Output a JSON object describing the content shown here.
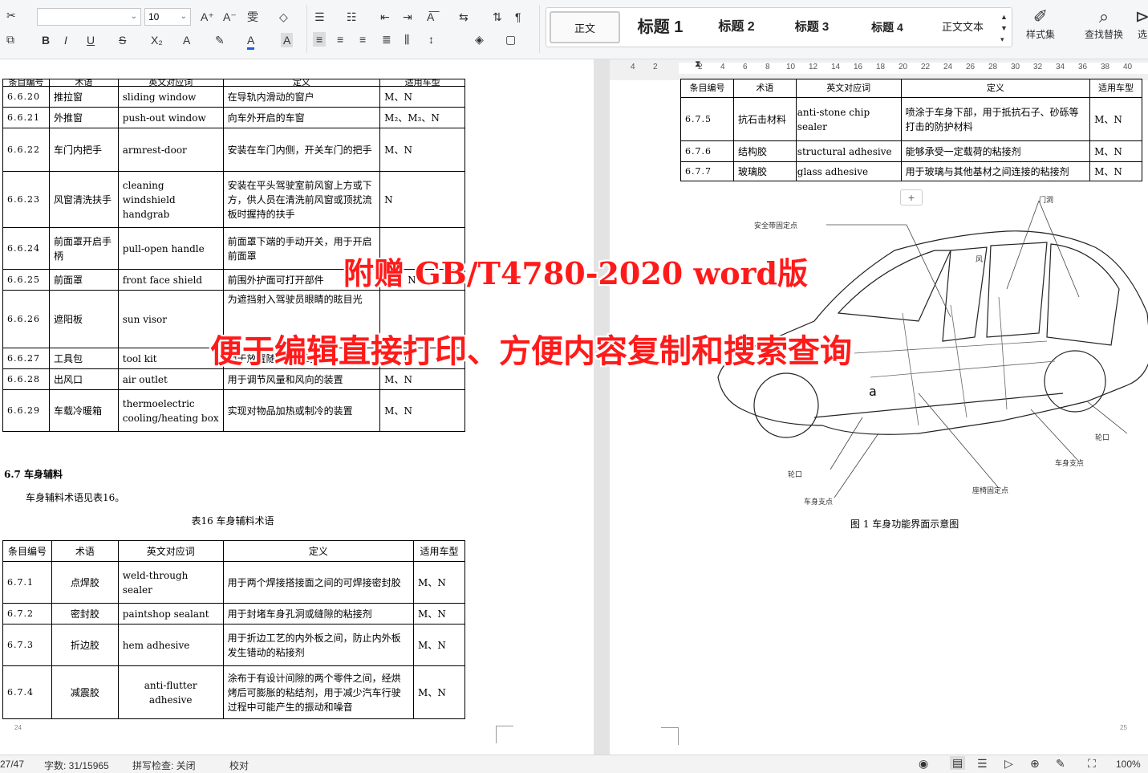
{
  "toolbar": {
    "font_name": "",
    "font_size": "10",
    "grow_font": "A⁺",
    "shrink_font": "A⁻",
    "phonetic": "雯",
    "clear": "◇",
    "bold": "B",
    "italic": "I",
    "underline": "U",
    "strike": "S",
    "subscript": "X₂",
    "highlight": "A",
    "font_color": "A",
    "char_shade": "A"
  },
  "styles": [
    {
      "label": "正文"
    },
    {
      "label": "标题 1"
    },
    {
      "label": "标题 2"
    },
    {
      "label": "标题 3"
    },
    {
      "label": "标题 4"
    },
    {
      "label": "正文文本"
    }
  ],
  "right_tools": {
    "style_set": "样式集",
    "find_replace": "查找替换",
    "select": "选"
  },
  "ruler": [
    "4",
    "2",
    "2",
    "4",
    "6",
    "8",
    "10",
    "12",
    "14",
    "16",
    "18",
    "20",
    "22",
    "24",
    "26",
    "28",
    "30",
    "32",
    "34",
    "36",
    "38",
    "40"
  ],
  "left_table_a": {
    "headers": [
      "条目编号",
      "术语",
      "英文对应词",
      "定义",
      "适用车型"
    ],
    "rows": [
      {
        "no": "6.6.20",
        "term": "推拉窗",
        "en": "sliding window",
        "def": "在导轨内滑动的窗户",
        "models": "M、N"
      },
      {
        "no": "6.6.21",
        "term": "外推窗",
        "en": "push-out window",
        "def": "向车外开启的车窗",
        "models": "M₂、M₃、N"
      },
      {
        "no": "6.6.22",
        "term": "车门内把手",
        "en": "armrest-door",
        "def": "安装在车门内侧，开关车门的把手",
        "models": "M、N"
      },
      {
        "no": "6.6.23",
        "term": "风窗清洗扶手",
        "en": "cleaning windshield handgrab",
        "def": "安装在平头驾驶室前风窗上方或下方，供人员在清洗前风窗或顶扰流板时握持的扶手",
        "models": "N"
      },
      {
        "no": "6.6.24",
        "term": "前面罩开启手柄",
        "en": "pull-open handle",
        "def": "前面罩下端的手动开关，用于开启前面罩",
        "models": ""
      },
      {
        "no": "6.6.25",
        "term": "前面罩",
        "en": "front face shield",
        "def": "前围外护面可打开部件",
        "models": "M₁、N"
      },
      {
        "no": "6.6.26",
        "term": "遮阳板",
        "en": "sun visor",
        "def": "为遮挡射入驾驶员眼睛的眩目光",
        "models": ""
      },
      {
        "no": "6.6.27",
        "term": "工具包",
        "en": "tool kit",
        "def": "用于放置随车工具的包",
        "models": "M、N"
      },
      {
        "no": "6.6.28",
        "term": "出风口",
        "en": "air outlet",
        "def": "用于调节风量和风向的装置",
        "models": "M、N"
      },
      {
        "no": "6.6.29",
        "term": "车载冷暖箱",
        "en": "thermoelectric cooling/heating box",
        "def": "实现对物品加热或制冷的装置",
        "models": "M、N"
      }
    ]
  },
  "section": {
    "heading": "6.7  车身辅料",
    "intro": "车身辅料术语见表16。",
    "caption": "表16  车身辅料术语"
  },
  "left_table_b": {
    "headers": [
      "条目编号",
      "术语",
      "英文对应词",
      "定义",
      "适用车型"
    ],
    "rows": [
      {
        "no": "6.7.1",
        "term": "点焊胶",
        "en": "weld-through sealer",
        "def": "用于两个焊接搭接面之间的可焊接密封胶",
        "models": "M、N"
      },
      {
        "no": "6.7.2",
        "term": "密封胶",
        "en": "paintshop sealant",
        "def": "用于封堵车身孔洞或缝隙的粘接剂",
        "models": "M、N"
      },
      {
        "no": "6.7.3",
        "term": "折边胶",
        "en": "hem adhesive",
        "def": "用于折边工艺的内外板之间，防止内外板发生错动的粘接剂",
        "models": "M、N"
      },
      {
        "no": "6.7.4",
        "term": "减震胶",
        "en": "anti-flutter adhesive",
        "def": "涂布于有设计间隙的两个零件之间，经烘烤后可膨胀的粘结剂，用于减少汽车行驶过程中可能产生的振动和噪音",
        "models": "M、N"
      }
    ]
  },
  "right_table": {
    "headers": [
      "条目编号",
      "术语",
      "英文对应词",
      "定义",
      "适用车型"
    ],
    "rows": [
      {
        "no": "6.7.5",
        "term": "抗石击材料",
        "en": "anti-stone chip sealer",
        "def": "喷涂于车身下部，用于抵抗石子、砂砾等打击的防护材料",
        "models": "M、N"
      },
      {
        "no": "6.7.6",
        "term": "结构胶",
        "en": "structural adhesive",
        "def": "能够承受一定载荷的粘接剂",
        "models": "M、N"
      },
      {
        "no": "6.7.7",
        "term": "玻璃胶",
        "en": "glass adhesive",
        "def": "用于玻璃与其他基材之间连接的粘接剂",
        "models": "M、N"
      }
    ]
  },
  "figure": {
    "labels": [
      "安全带固定点",
      "风",
      "门洞",
      "轮口",
      "车身支点",
      "座椅固定点",
      "轮口",
      "车身支点",
      "a"
    ],
    "caption": "图 1   车身功能界面示意图"
  },
  "page_numbers": {
    "left": "24",
    "right": "25"
  },
  "overlay": {
    "line1": "附赠 GB/T4780-2020 word版",
    "line2": "便于编辑直接打印、方便内容复制和搜索查询"
  },
  "status": {
    "page": "27/47",
    "words": "字数: 31/15965",
    "spell": "拼写检查: 关闭",
    "proof": "校对",
    "zoom": "100%"
  },
  "colors": {
    "overlay": "#ff1a1a",
    "ribbon": "#f5f6f8",
    "accent_blue": "#1f5fd6"
  }
}
